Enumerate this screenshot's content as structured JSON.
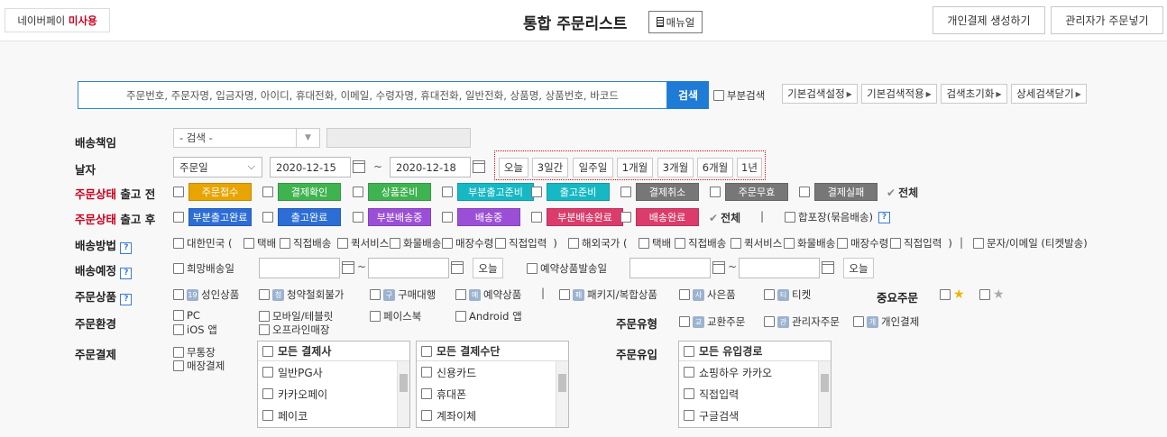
{
  "header": {
    "naverpay_label": "네이버페이",
    "naverpay_status": "미사용",
    "title": "통합 주문리스트",
    "manual_label": "매뉴얼",
    "btn_personal_payment": "개인결제 생성하기",
    "btn_admin_order": "관리자가 주문넣기"
  },
  "search": {
    "placeholder": "주문번호, 주문자명, 입금자명, 아이디, 휴대전화, 이메일, 수령자명, 휴대전화, 일반전화, 상품명, 상품번호, 바코드",
    "button": "검색",
    "partial_label": "부분검색",
    "presets": [
      "기본검색설정",
      "기본검색적용",
      "검색초기화",
      "상세검색닫기"
    ]
  },
  "shipping_responsibility": {
    "label": "배송책임",
    "select_value": "- 검색 -"
  },
  "date": {
    "label": "날자",
    "type_value": "주문일",
    "start": "2020-12-15",
    "end": "2020-12-18",
    "separator": "~",
    "quick": [
      "오늘",
      "3일간",
      "일주일",
      "1개월",
      "3개월",
      "6개월",
      "1년"
    ]
  },
  "status_before": {
    "label_red": "주문상태",
    "label_rest": "출고 전",
    "items": [
      {
        "text": "주문접수",
        "color": "#e8a400"
      },
      {
        "text": "결제확인",
        "color": "#3fb34f"
      },
      {
        "text": "상품준비",
        "color": "#3fb34f"
      },
      {
        "text": "부분출고준비",
        "color": "#16b8c4"
      },
      {
        "text": "출고준비",
        "color": "#16b8c4"
      },
      {
        "text": "결제취소",
        "color": "#777777"
      },
      {
        "text": "주문무효",
        "color": "#777777"
      },
      {
        "text": "결제실패",
        "color": "#777777"
      }
    ],
    "all_label": "전체"
  },
  "status_after": {
    "label_red": "주문상태",
    "label_rest": "출고 후",
    "items": [
      {
        "text": "부분출고완료",
        "color": "#2c6ed5"
      },
      {
        "text": "출고완료",
        "color": "#2c6ed5"
      },
      {
        "text": "부분배송중",
        "color": "#9b4fd6"
      },
      {
        "text": "배송중",
        "color": "#9b4fd6"
      },
      {
        "text": "부분배송완료",
        "color": "#db3c6c"
      },
      {
        "text": "배송완료",
        "color": "#db3c6c"
      }
    ],
    "all_label": "전체",
    "divider": "|",
    "bundle_label": "합포장(묶음배송)"
  },
  "shipping_method": {
    "label": "배송방법",
    "domestic": "대한민국 (",
    "domestic_opts": [
      "택배",
      "직접배송",
      "퀵서비스",
      "화물배송",
      "매장수령",
      "직접입력"
    ],
    "domestic_close": ")",
    "overseas": "해외국가 (",
    "overseas_opts": [
      "택배",
      "직접배송",
      "퀵서비스",
      "화물배송",
      "매장수령",
      "직접입력"
    ],
    "overseas_close": ")",
    "divider": "|",
    "sms": "문자/이메일 (티켓발송)"
  },
  "shipping_schedule": {
    "label": "배송예정",
    "hope_label": "희망배송일",
    "today": "오늘",
    "reserve_label": "예약상품발송일",
    "separator": "~"
  },
  "order_goods": {
    "label": "주문상품",
    "items": [
      {
        "badge": "19",
        "text": "성인상품"
      },
      {
        "badge": "청",
        "text": "청약철회불가"
      },
      {
        "badge": "구",
        "text": "구매대행"
      },
      {
        "badge": "예",
        "text": "예약상품"
      }
    ],
    "divider": "|",
    "items2": [
      {
        "badge": "패",
        "text": "패키지/복합상품"
      },
      {
        "badge": "사",
        "text": "사은품"
      },
      {
        "badge": "티",
        "text": "티켓"
      }
    ],
    "important_label": "중요주문"
  },
  "order_env": {
    "label": "주문환경",
    "items": [
      "PC",
      "iOS 앱",
      "모바일/테블릿",
      "오프라인매장",
      "페이스북",
      "Android 앱"
    ]
  },
  "order_type": {
    "label": "주문유형",
    "items": [
      {
        "badge": "교",
        "text": "교환주문"
      },
      {
        "badge": "관",
        "text": "관리자주문"
      },
      {
        "badge": "개",
        "text": "개인결제"
      }
    ]
  },
  "order_payment": {
    "label": "주문결제",
    "items": [
      "무통장",
      "매장결제"
    ],
    "company_head": "모든 결제사",
    "companies": [
      "일반PG사",
      "카카오페이",
      "페이코"
    ],
    "method_head": "모든 결제수단",
    "methods": [
      "신용카드",
      "휴대폰",
      "계좌이체"
    ]
  },
  "order_inflow": {
    "label": "주문유입",
    "head": "모든 유입경로",
    "items": [
      "쇼핑하우 카카오",
      "직접입력",
      "구글검색"
    ]
  }
}
